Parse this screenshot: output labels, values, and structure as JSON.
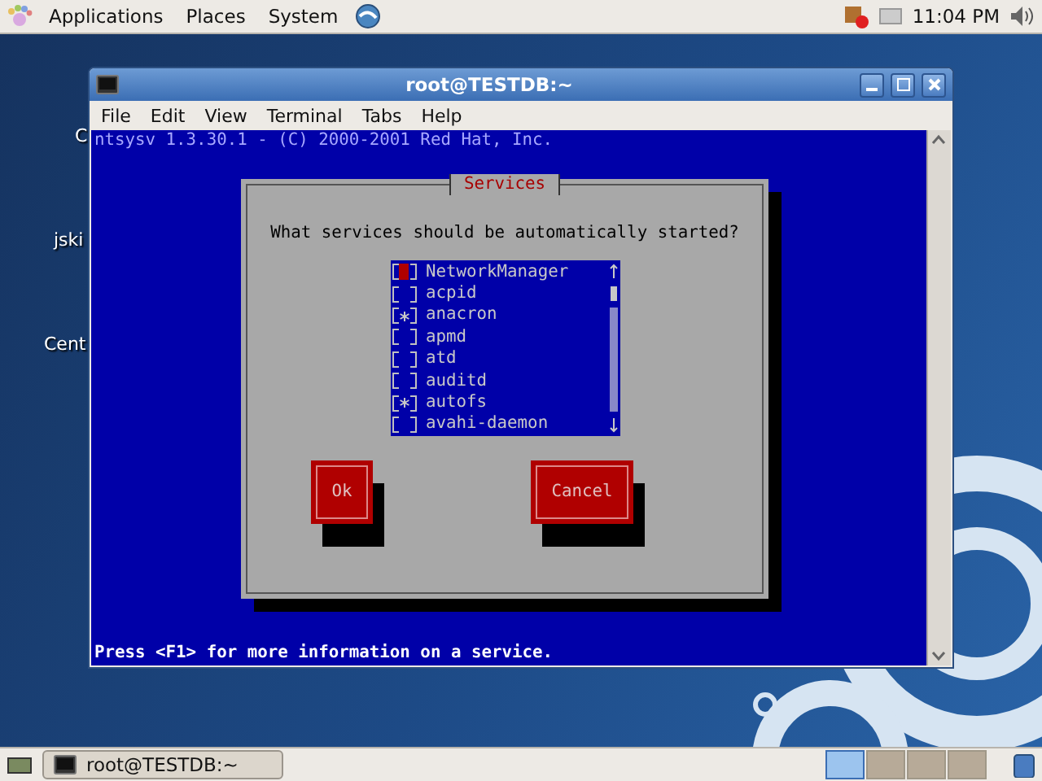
{
  "top_panel": {
    "menus": [
      "Applications",
      "Places",
      "System"
    ],
    "clock": "11:04 PM"
  },
  "desktop_icons": [
    "C",
    "jski",
    "Cent"
  ],
  "window": {
    "title": "root@TESTDB:~",
    "menu": [
      "File",
      "Edit",
      "View",
      "Terminal",
      "Tabs",
      "Help"
    ]
  },
  "terminal": {
    "header": "ntsysv 1.3.30.1 - (C) 2000-2001 Red Hat, Inc.",
    "footer": "Press <F1> for more information on a service."
  },
  "dialog": {
    "title": "Services",
    "question": "What services should be automatically started?",
    "services": [
      {
        "name": "NetworkManager",
        "checked": false,
        "selected": true
      },
      {
        "name": "acpid",
        "checked": false,
        "selected": false
      },
      {
        "name": "anacron",
        "checked": true,
        "selected": false
      },
      {
        "name": "apmd",
        "checked": false,
        "selected": false
      },
      {
        "name": "atd",
        "checked": false,
        "selected": false
      },
      {
        "name": "auditd",
        "checked": false,
        "selected": false
      },
      {
        "name": "autofs",
        "checked": true,
        "selected": false
      },
      {
        "name": "avahi-daemon",
        "checked": false,
        "selected": false
      }
    ],
    "buttons": [
      "Ok",
      "Cancel"
    ]
  },
  "taskbar": {
    "task": "root@TESTDB:~",
    "workspaces": [
      {
        "selected": true
      },
      {
        "selected": false
      },
      {
        "selected": false
      },
      {
        "selected": false
      }
    ]
  }
}
